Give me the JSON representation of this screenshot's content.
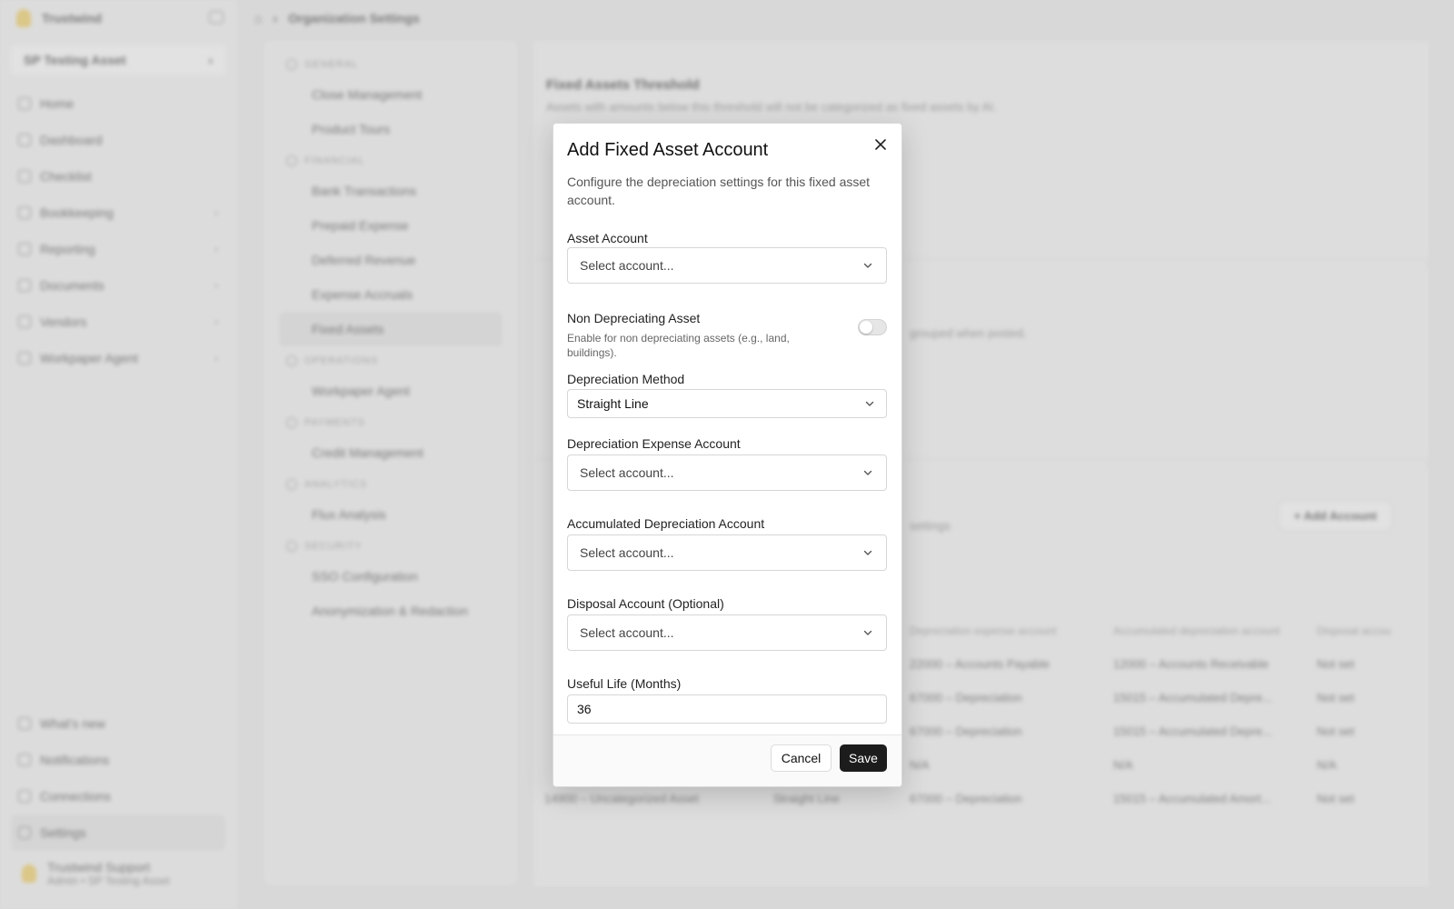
{
  "background": {
    "brand": "Trustwind",
    "workspace": "SP Testing Asset",
    "nav": [
      "Home",
      "Dashboard",
      "Checklist",
      "Bookkeeping",
      "Reporting",
      "Documents",
      "Vendors",
      "Workpaper Agent"
    ],
    "nav_bottom": [
      "What's new",
      "Notifications",
      "Connections",
      "Settings"
    ],
    "user_name": "Trustwind Support",
    "user_role": "Admin • SP Testing Asset",
    "breadcrumb": "Organization Settings",
    "settings_groups": [
      {
        "title": "GENERAL",
        "items": [
          "Close Management",
          "Product Tours"
        ]
      },
      {
        "title": "FINANCIAL",
        "items": [
          "Bank Transactions",
          "Prepaid Expense",
          "Deferred Revenue",
          "Expense Accruals",
          "Fixed Assets"
        ]
      },
      {
        "title": "OPERATIONS",
        "items": [
          "Workpaper Agent"
        ]
      },
      {
        "title": "PAYMENTS",
        "items": [
          "Credit Management"
        ]
      },
      {
        "title": "ANALYTICS",
        "items": [
          "Flux Analysis"
        ]
      },
      {
        "title": "SECURITY",
        "items": [
          "SSO Configuration",
          "Anonymization & Redaction"
        ]
      }
    ],
    "threshold_title": "Fixed Assets Threshold",
    "threshold_desc": "Assets with amounts below this threshold will not be categorized as fixed assets by AI.",
    "grouping_desc": "grouped when posted.",
    "accounts_desc": "settings",
    "add_account_label": "Add Account",
    "table_headers": [
      "",
      "",
      "Depreciation expense account",
      "Accumulated depreciation account",
      "Disposal accou"
    ],
    "table_rows": [
      [
        "",
        "",
        "22000 – Accounts Payable",
        "12000 – Accounts Receivable",
        "Not set"
      ],
      [
        "",
        "",
        "67000 – Depreciation",
        "15015 – Accumulated Depre...",
        "Not set"
      ],
      [
        "",
        "",
        "67000 – Depreciation",
        "15015 – Accumulated Depre...",
        "Not set"
      ],
      [
        "",
        "",
        "N/A",
        "N/A",
        "N/A"
      ],
      [
        "14900 – Uncategorized Asset",
        "Straight Line",
        "67000 – Depreciation",
        "15015 – Accumulated Amort...",
        "Not set"
      ]
    ]
  },
  "modal": {
    "title": "Add Fixed Asset Account",
    "description": "Configure the depreciation settings for this fixed asset account.",
    "asset_account": {
      "label": "Asset Account",
      "placeholder": "Select account..."
    },
    "non_depreciating": {
      "label": "Non Depreciating Asset",
      "hint": "Enable for non depreciating assets (e.g., land, buildings).",
      "enabled": false
    },
    "depreciation_method": {
      "label": "Depreciation Method",
      "value": "Straight Line"
    },
    "expense_account": {
      "label": "Depreciation Expense Account",
      "placeholder": "Select account..."
    },
    "accumulated_account": {
      "label": "Accumulated Depreciation Account",
      "placeholder": "Select account..."
    },
    "disposal_account": {
      "label": "Disposal Account (Optional)",
      "placeholder": "Select account..."
    },
    "useful_life": {
      "label": "Useful Life (Months)",
      "value": "36"
    },
    "cancel_label": "Cancel",
    "save_label": "Save"
  },
  "colors": {
    "primary_button": "#1c1c1c",
    "overlay": "rgba(0,0,0,0.08)"
  }
}
